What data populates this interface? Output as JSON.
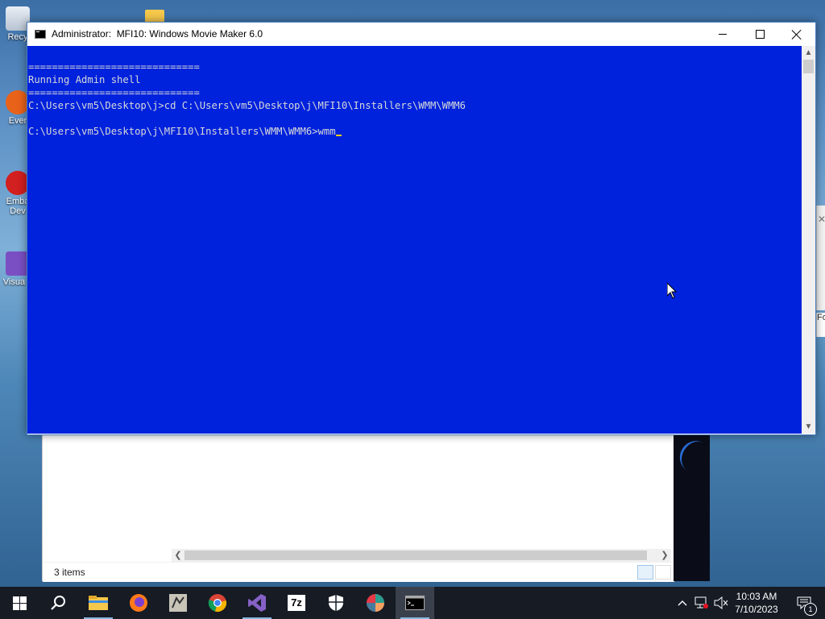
{
  "desktop": {
    "icons": [
      {
        "label": "Recy",
        "icon": "recycle-bin-icon"
      },
      {
        "label": "Ever",
        "icon": "everything-icon"
      },
      {
        "label": "Emba Dev",
        "icon": "embarcadero-icon"
      },
      {
        "label": "Visua 2",
        "icon": "visual-studio-icon"
      }
    ]
  },
  "console": {
    "title": "Administrator:  MFI10: Windows Movie Maker 6.0",
    "lines": [
      "=============================",
      "Running Admin shell",
      "=============================",
      "C:\\Users\\vm5\\Desktop\\j>cd C:\\Users\\vm5\\Desktop\\j\\MFI10\\Installers\\WMM\\WMM6",
      "",
      "C:\\Users\\vm5\\Desktop\\j\\MFI10\\Installers\\WMM\\WMM6>wmm"
    ],
    "background_color": "#0022dd",
    "text_color": "#d8d8d8"
  },
  "explorer": {
    "status_text": "3 items"
  },
  "right_window": {
    "partial_text": "Fo"
  },
  "taskbar": {
    "items": [
      {
        "name": "start-button",
        "icon": "windows-logo-icon"
      },
      {
        "name": "search-button",
        "icon": "search-icon"
      },
      {
        "name": "file-explorer-button",
        "icon": "folder-icon"
      },
      {
        "name": "firefox-button",
        "icon": "firefox-icon"
      },
      {
        "name": "tool-button",
        "icon": "hand-tool-icon"
      },
      {
        "name": "chrome-button",
        "icon": "chrome-icon"
      },
      {
        "name": "visual-studio-button",
        "icon": "visual-studio-icon"
      },
      {
        "name": "7zip-button",
        "icon": "7zip-icon",
        "label": "7z"
      },
      {
        "name": "security-button",
        "icon": "shield-icon"
      },
      {
        "name": "color-app-button",
        "icon": "color-wheel-icon"
      },
      {
        "name": "console-button",
        "icon": "console-icon"
      }
    ],
    "clock": {
      "time": "10:03 AM",
      "date": "7/10/2023"
    },
    "notification_count": "1"
  }
}
